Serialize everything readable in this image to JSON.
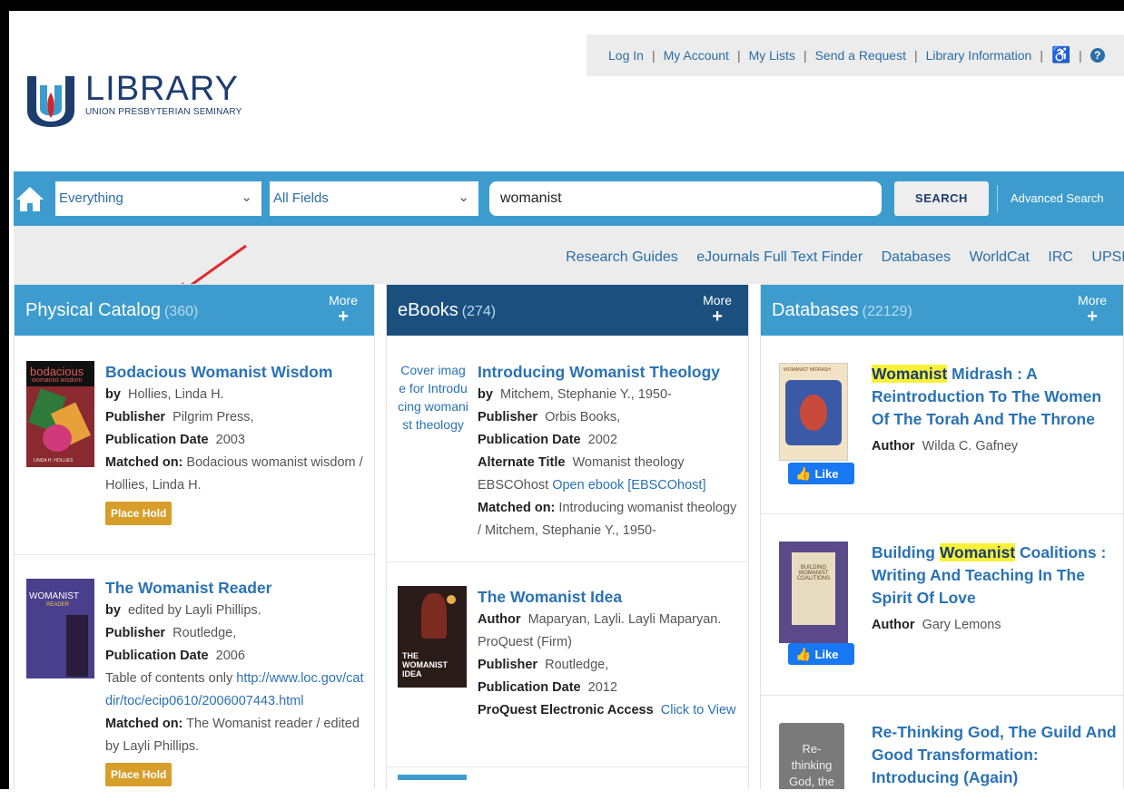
{
  "util_links": [
    "Log In",
    "My Account",
    "My Lists",
    "Send a Request",
    "Library Information"
  ],
  "logo": {
    "title": "LIBRARY",
    "subtitle": "UNION PRESBYTERIAN SEMINARY"
  },
  "search": {
    "scope": "Everything",
    "field": "All Fields",
    "query": "womanist",
    "button": "SEARCH",
    "advanced": "Advanced Search"
  },
  "quick_links": [
    "Research Guides",
    "eJournals Full Text Finder",
    "Databases",
    "WorldCat",
    "IRC",
    "UPSE"
  ],
  "colors": {
    "primary": "#3d9ccd",
    "dark": "#1a4f7e",
    "link": "#2a72b5",
    "hold": "#d79e2c",
    "highlight": "#f7f13a"
  },
  "columns": [
    {
      "title": "Physical Catalog",
      "count": "(360)",
      "more": "More",
      "records": [
        {
          "title": "Bodacious Womanist Wisdom",
          "cover_title": "bodacious",
          "cover_sub": "womanist wisdom",
          "cover_author": "LINDA H. HOLLIES",
          "by_label": "by",
          "by": "Hollies, Linda H.",
          "pub_label": "Publisher",
          "publisher": "Pilgrim Press,",
          "date_label": "Publication Date",
          "date": "2003",
          "match_label": "Matched on:",
          "matched": "Bodacious womanist wisdom / Hollies, Linda H.",
          "hold": "Place Hold"
        },
        {
          "title": "The Womanist Reader",
          "cover_title": "WOMANIST",
          "cover_sub": "READER",
          "by_label": "by",
          "by": "edited by Layli Phillips.",
          "pub_label": "Publisher",
          "publisher": "Routledge,",
          "date_label": "Publication Date",
          "date": "2006",
          "toc_text": "Table of contents only",
          "toc_link": "http://www.loc.gov/catdir/toc/ecip0610/2006007443.html",
          "match_label": "Matched on:",
          "matched": "The Womanist reader / edited by Layli Phillips.",
          "hold": "Place Hold"
        }
      ]
    },
    {
      "title": "eBooks",
      "count": "(274)",
      "more": "More",
      "records": [
        {
          "title": "Introducing Womanist Theology",
          "cover_alt": "Cover image for Introducing womanist theology",
          "by_label": "by",
          "by": "Mitchem, Stephanie Y., 1950-",
          "pub_label": "Publisher",
          "publisher": "Orbis Books,",
          "date_label": "Publication Date",
          "date": "2002",
          "alt_label": "Alternate Title",
          "alt_title": "Womanist theology",
          "ebsco_text": "EBSCOhost",
          "ebsco_link": "Open ebook [EBSCOhost]",
          "match_label": "Matched on:",
          "matched": "Introducing womanist theology / Mitchem, Stephanie Y., 1950-"
        },
        {
          "title": "The Womanist Idea",
          "cover_title": "THE WOMANIST IDEA",
          "author_label": "Author",
          "author": "Maparyan, Layli. Layli Maparyan. ProQuest (Firm)",
          "pub_label": "Publisher",
          "publisher": "Routledge,",
          "date_label": "Publication Date",
          "date": "2012",
          "access_label": "ProQuest Electronic Access",
          "access_link": "Click to View"
        }
      ]
    },
    {
      "title": "Databases",
      "count": "(22129)",
      "more": "More",
      "records": [
        {
          "title_hl": "Womanist",
          "title_rest": " Midrash : A Reintroduction To The Women Of The Torah And The Throne",
          "cover_title": "WOMANIST MIDRASH",
          "author_label": "Author",
          "author": "Wilda C. Gafney",
          "like": "Like"
        },
        {
          "title_pre": "Building ",
          "title_hl": "Womanist",
          "title_rest": " Coalitions : Writing And Teaching In The Spirit Of Love",
          "cover_title": "BUILDING WOMANIST COALITIONS",
          "author_label": "Author",
          "author": "Gary Lemons",
          "like": "Like"
        },
        {
          "title": "Re-Thinking God, The Guild And Good Transformation: Introducing (Again)",
          "cover_alt": "Re-thinking God, the"
        }
      ]
    }
  ]
}
